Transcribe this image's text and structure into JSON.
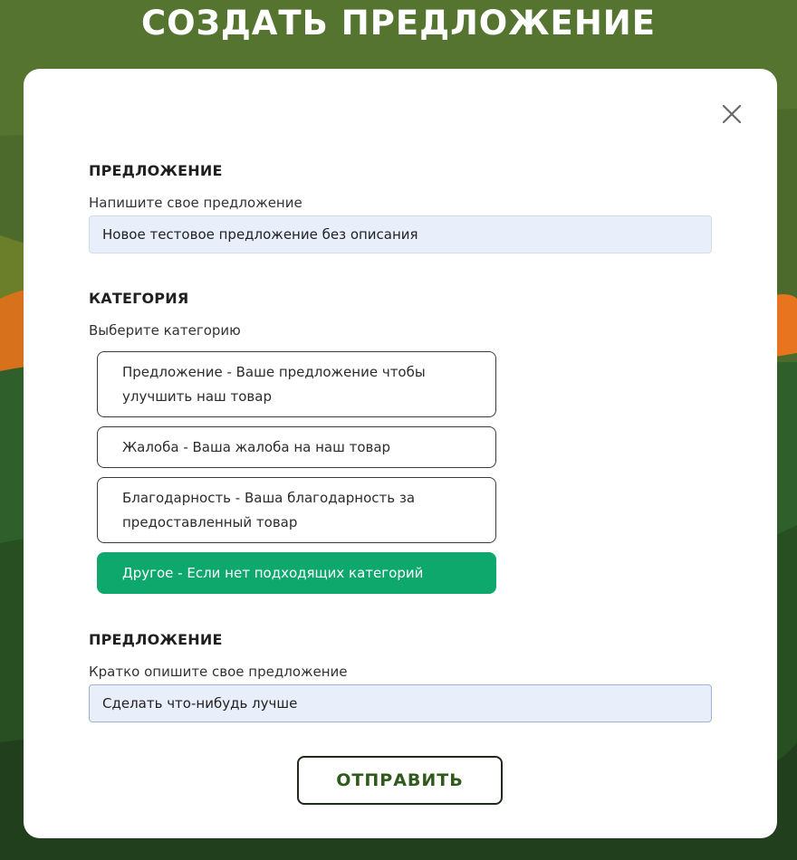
{
  "page": {
    "title": "СОЗДАТЬ ПРЕДЛОЖЕНИЕ"
  },
  "colors": {
    "background_green": "#4c6a2c",
    "accent_green": "#0ea86c",
    "input_bg": "#e8effb",
    "orange": "#e8741f",
    "button_text": "#2f5a1c"
  },
  "modal": {
    "close_icon": "close-icon",
    "proposal_section": {
      "heading": "ПРЕДЛОЖЕНИЕ",
      "label": "Напишите свое предложение",
      "value": "Новое тестовое предложение без описания"
    },
    "category_section": {
      "heading": "КАТЕГОРИЯ",
      "label": "Выберите категорию",
      "options": [
        {
          "text": "Предложение - Ваше предложение чтобы улучшить наш товар",
          "selected": false
        },
        {
          "text": "Жалоба - Ваша жалоба на наш товар",
          "selected": false
        },
        {
          "text": "Благодарность - Ваша благодарность за предоставленный товар",
          "selected": false
        },
        {
          "text": "Другое - Если нет подходящих категорий",
          "selected": true
        }
      ]
    },
    "description_section": {
      "heading": "ПРЕДЛОЖЕНИЕ",
      "label": "Кратко опишите свое предложение",
      "value": "Сделать что-нибудь лучше"
    },
    "submit_label": "ОТПРАВИТЬ"
  }
}
